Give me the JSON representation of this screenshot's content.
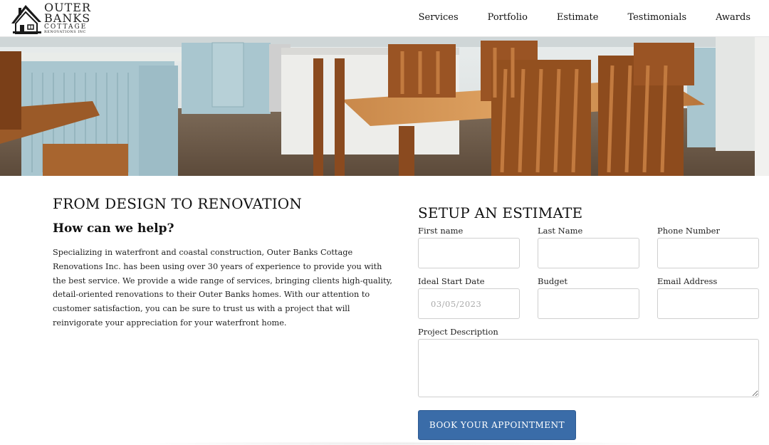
{
  "brand": {
    "line1": "OUTER",
    "line2": "BANKS",
    "line3": "COTTAGE",
    "line4": "RENOVATIONS INC"
  },
  "nav": {
    "items": [
      {
        "label": "Services"
      },
      {
        "label": "Portfolio"
      },
      {
        "label": "Estimate"
      },
      {
        "label": "Testimonials"
      },
      {
        "label": "Awards"
      }
    ]
  },
  "hero": {
    "icon": "kitchen-photo",
    "colors": {
      "cabinet": "#a9c6cf",
      "wood": "#8a4a1f",
      "floor": "#6e5a48"
    }
  },
  "intro": {
    "heading": "FROM DESIGN TO RENOVATION",
    "subheading": "How can we help?",
    "body": "Specializing in waterfront and coastal construction, Outer Banks Cottage Renovations Inc. has been using over 30 years of experience to provide you with the best service. We provide a wide range of services, bringing clients high-quality, detail-oriented renovations to their Outer Banks homes. With our attention to customer satisfaction, you can be sure to trust us with a project that will reinvigorate your appreciation for your waterfront home."
  },
  "form": {
    "title": "SETUP AN ESTIMATE",
    "fields": {
      "first_name": {
        "label": "First name",
        "value": ""
      },
      "last_name": {
        "label": "Last Name",
        "value": ""
      },
      "phone": {
        "label": "Phone Number",
        "value": ""
      },
      "start_date": {
        "label": "Ideal Start Date",
        "value": "03/05/2023"
      },
      "budget": {
        "label": "Budget",
        "value": ""
      },
      "email": {
        "label": "Email Address",
        "value": ""
      },
      "description": {
        "label": "Project Description",
        "value": ""
      }
    },
    "submit_label": "BOOK YOUR APPOINTMENT"
  },
  "colors": {
    "accent": "#3a6ca8",
    "text": "#111111",
    "border": "#cfcfcf"
  }
}
